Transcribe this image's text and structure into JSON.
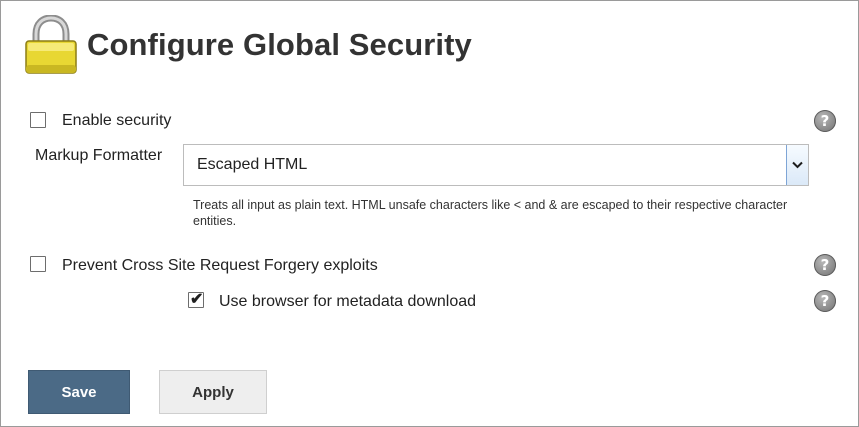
{
  "header": {
    "title": "Configure Global Security",
    "icon": "lock-icon"
  },
  "security": {
    "enable_label": "Enable security",
    "enable_checked": false
  },
  "markup_formatter": {
    "label": "Markup Formatter",
    "selected": "Escaped HTML",
    "description": "Treats all input as plain text. HTML unsafe characters like < and & are escaped to their respective character entities."
  },
  "csrf": {
    "label": "Prevent Cross Site Request Forgery exploits",
    "checked": false
  },
  "metadata": {
    "label": "Use browser for metadata download",
    "checked": true
  },
  "help": {
    "icon_glyph": "?"
  },
  "buttons": {
    "save_label": "Save",
    "apply_label": "Apply"
  },
  "colors": {
    "save_bg": "#4b6a86",
    "apply_bg": "#eeeeee",
    "lock_body": "#e8d733",
    "help_icon": "#8f8f8f"
  }
}
